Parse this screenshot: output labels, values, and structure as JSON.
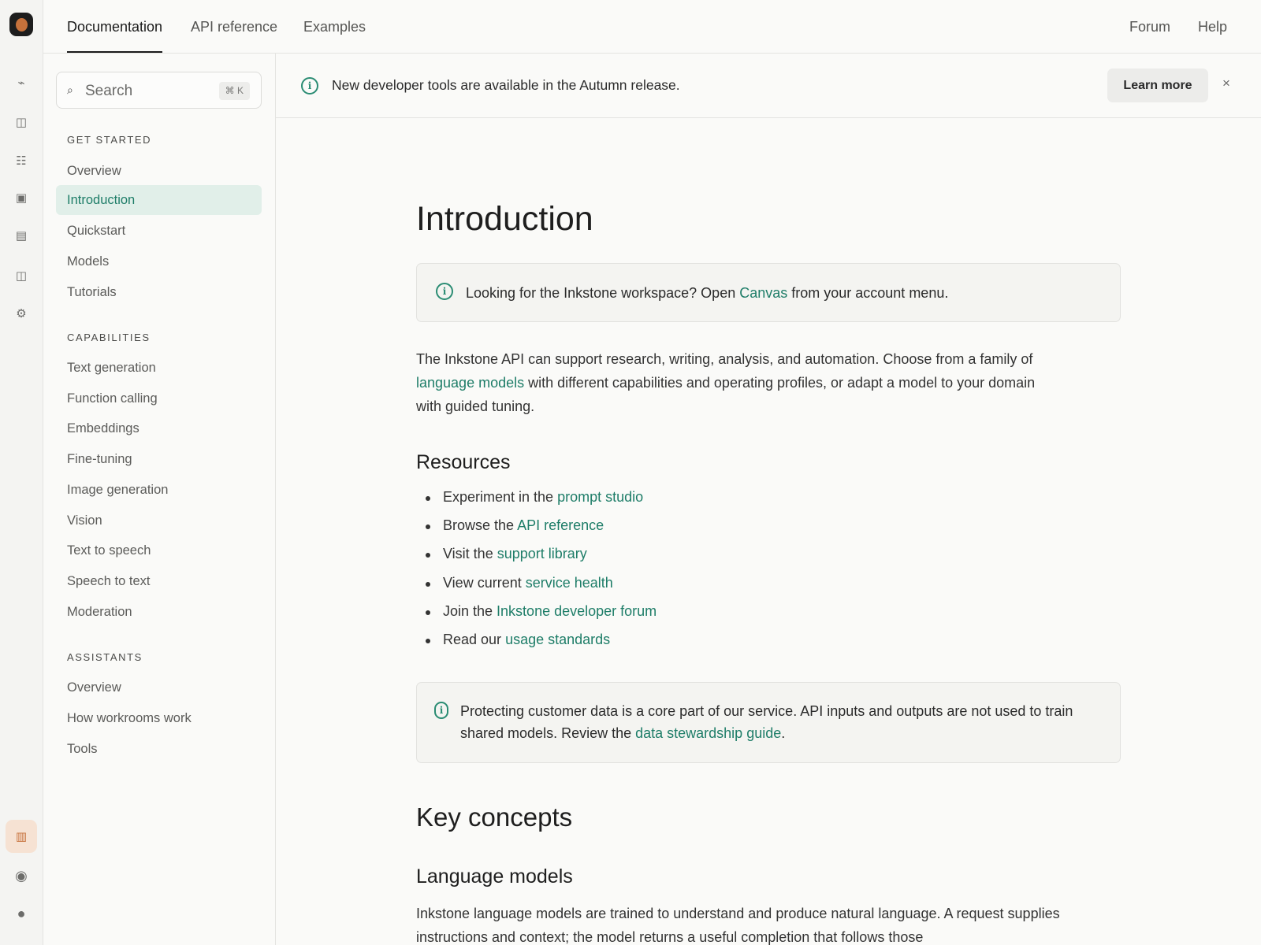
{
  "rail": {
    "icons": [
      "activity-icon",
      "book-icon",
      "list-icon",
      "image-icon",
      "table-icon",
      "columns-icon",
      "gear-icon"
    ],
    "bottom_icons": [
      "library-icon",
      "record-icon",
      "user-avatar-icon"
    ]
  },
  "topnav": {
    "items": [
      "Documentation",
      "API reference",
      "Examples"
    ],
    "right_items": [
      "Forum",
      "Help"
    ]
  },
  "search": {
    "label": "Search",
    "shortcut": "⌘ K"
  },
  "sidebar": {
    "sections": [
      {
        "title": "GET STARTED",
        "items": [
          "Overview",
          "Introduction",
          "Quickstart",
          "Models",
          "Tutorials"
        ]
      },
      {
        "title": "CAPABILITIES",
        "items": [
          "Text generation",
          "Function calling",
          "Embeddings",
          "Fine-tuning",
          "Image generation",
          "Vision",
          "Text to speech",
          "Speech to text",
          "Moderation"
        ]
      },
      {
        "title": "ASSISTANTS",
        "items": [
          "Overview",
          "How workrooms work",
          "Tools"
        ]
      }
    ],
    "active_item": "Introduction"
  },
  "banner": {
    "text": "New developer tools are available in the Autumn release.",
    "button": "Learn more",
    "close": "×"
  },
  "content": {
    "title": "Introduction",
    "callout1": {
      "before": "Looking for the Inkstone workspace? Open ",
      "link": "Canvas",
      "after": " from your account menu."
    },
    "intro": {
      "part1": "The Inkstone API can support research, writing, analysis, and automation. Choose from a family of ",
      "link": "language models",
      "part2": " with different capabilities and operating profiles, or adapt a model to your domain with guided tuning."
    },
    "resources_heading": "Resources",
    "resources": [
      {
        "prefix": "Experiment in the ",
        "link": "prompt studio"
      },
      {
        "prefix": "Browse the ",
        "link": "API reference"
      },
      {
        "prefix": "Visit the ",
        "link": "support library"
      },
      {
        "prefix": "View current ",
        "link": "service health"
      },
      {
        "prefix": "Join the ",
        "link": "Inkstone developer forum"
      },
      {
        "prefix": "Read our ",
        "link": "usage standards"
      }
    ],
    "callout2": {
      "before": "Protecting customer data is a core part of our service. API inputs and outputs are not used to train shared models. Review the ",
      "link": "data stewardship guide",
      "after": "."
    },
    "key_concepts_heading": "Key concepts",
    "language_models_heading": "Language models",
    "language_models_text": "Inkstone language models are trained to understand and produce natural language. A request supplies instructions and context; the model returns a useful completion that follows those"
  },
  "colors": {
    "accent": "#1e7d68",
    "active_nav_bg": "#e1efe9",
    "brand_orange": "#c6713b"
  }
}
